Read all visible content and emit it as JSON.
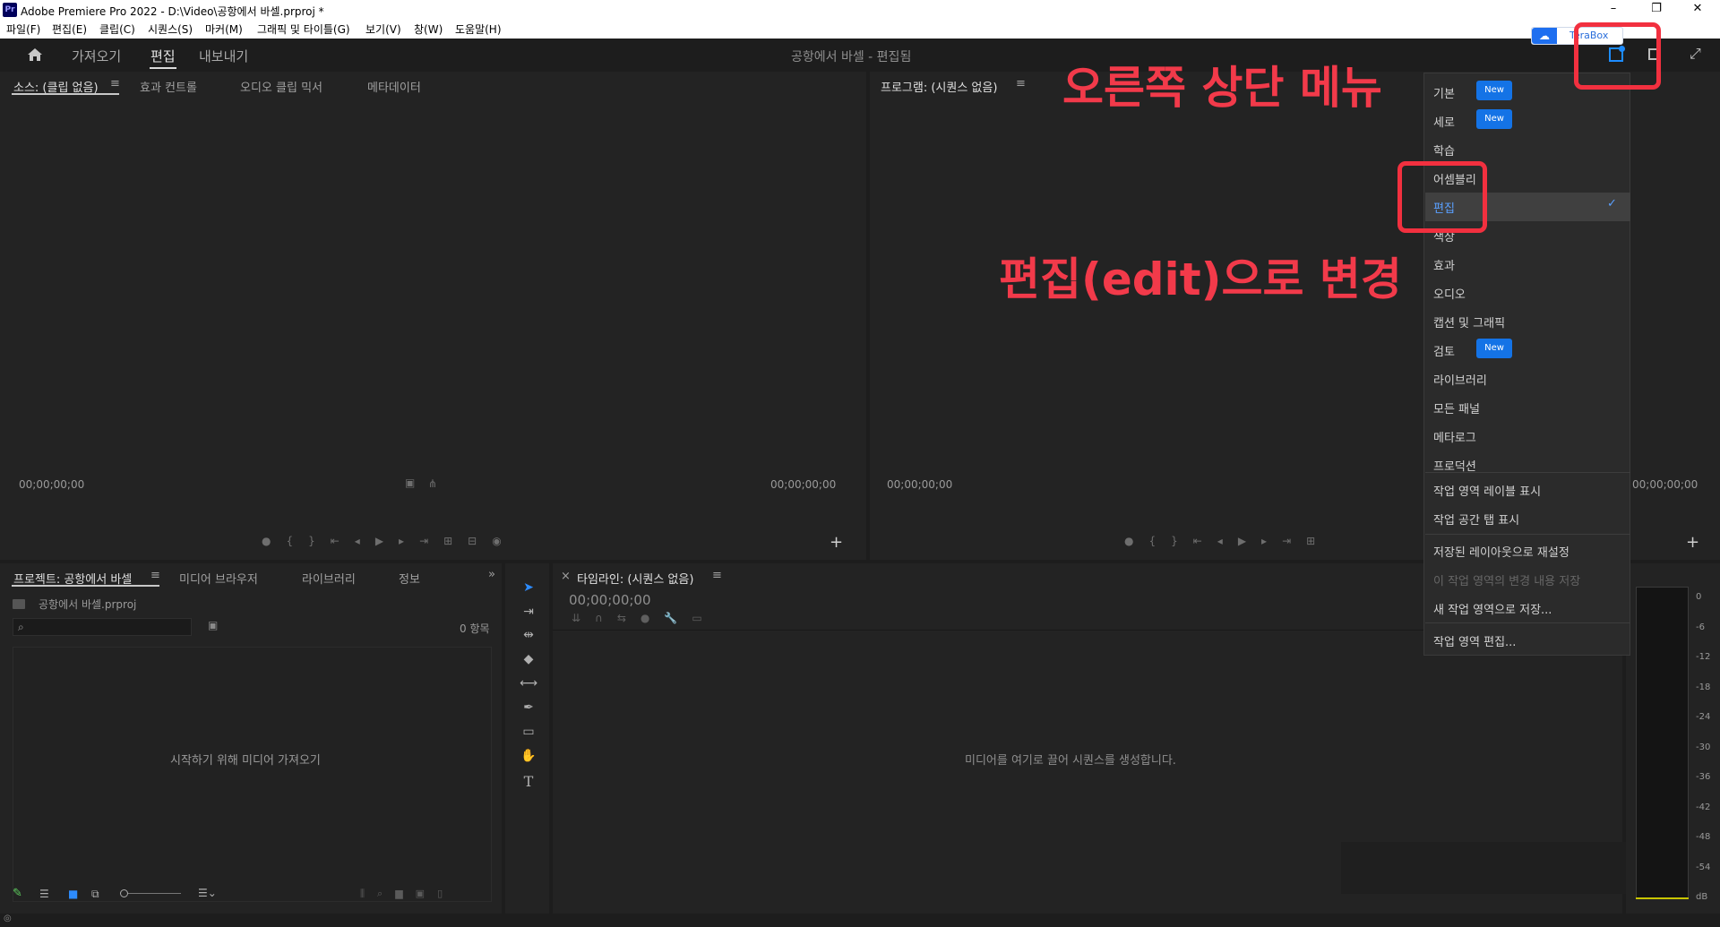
{
  "window": {
    "title": "Adobe Premiere Pro 2022 - D:\\Video\\공항에서 바셀.prproj *",
    "logo": "Pr"
  },
  "menubar": [
    "파일(F)",
    "편집(E)",
    "클립(C)",
    "시퀀스(S)",
    "마커(M)",
    "그래픽 및 타이틀(G)",
    "보기(V)",
    "창(W)",
    "도움말(H)"
  ],
  "header": {
    "nav": [
      "가져오기",
      "편집",
      "내보내기"
    ],
    "active": "편집",
    "project_title": "공항에서 바셀 - 편집됨",
    "terabox": "TeraBox"
  },
  "source_panel": {
    "tabs": [
      "소스: (클립 없음)",
      "효과 컨트롤",
      "오디오 클립 믹서",
      "메타데이터"
    ],
    "tc_left": "00;00;00;00",
    "tc_right": "00;00;00;00"
  },
  "program_panel": {
    "title": "프로그램: (시퀀스 없음)",
    "tc_left": "00;00;00;00",
    "tc_right": "00;00;00;00"
  },
  "project_panel": {
    "tabs": [
      "프로젝트: 공항에서 바셀",
      "미디어 브라우저",
      "라이브러리",
      "정보"
    ],
    "file": "공항에서 바셀.prproj",
    "count": "0 항목",
    "empty_msg": "시작하기 위해 미디어 가져오기"
  },
  "timeline_panel": {
    "title": "타임라인: (시퀀스 없음)",
    "tc": "00;00;00;00",
    "empty_msg": "미디어를 여기로 끌어 시퀀스를 생성합니다."
  },
  "meter": {
    "labels": [
      "0",
      "-6",
      "-12",
      "-18",
      "-24",
      "-30",
      "-36",
      "-42",
      "-48",
      "-54",
      "dB"
    ]
  },
  "workspace_menu": {
    "items": [
      {
        "label": "기본",
        "badge": "New"
      },
      {
        "label": "세로",
        "badge": "New"
      },
      {
        "label": "학습"
      },
      {
        "label": "어셈블리"
      },
      {
        "label": "편집",
        "selected": true,
        "checked": true
      },
      {
        "label": "색상"
      },
      {
        "label": "효과"
      },
      {
        "label": "오디오"
      },
      {
        "label": "캡션 및 그래픽"
      },
      {
        "label": "검토",
        "badge": "New"
      },
      {
        "label": "라이브러리"
      },
      {
        "label": "모든 패널"
      },
      {
        "label": "메타로그"
      },
      {
        "label": "프로덕션"
      }
    ],
    "options": [
      "작업 영역 레이블 표시",
      "작업 공간 탭 표시",
      "저장된 레이아웃으로 재설정",
      "이 작업 영역의 변경 내용 저장",
      "새 작업 영역으로 저장...",
      "작업 영역 편집..."
    ],
    "check": "✓"
  },
  "annotations": {
    "top_menu": "오른쪽 상단 메뉴",
    "change_to_edit": "편집(edit)으로 변경"
  },
  "colors": {
    "accent": "#1473e6",
    "annotation": "#f2303f",
    "selected_text": "#5aa0ff"
  }
}
